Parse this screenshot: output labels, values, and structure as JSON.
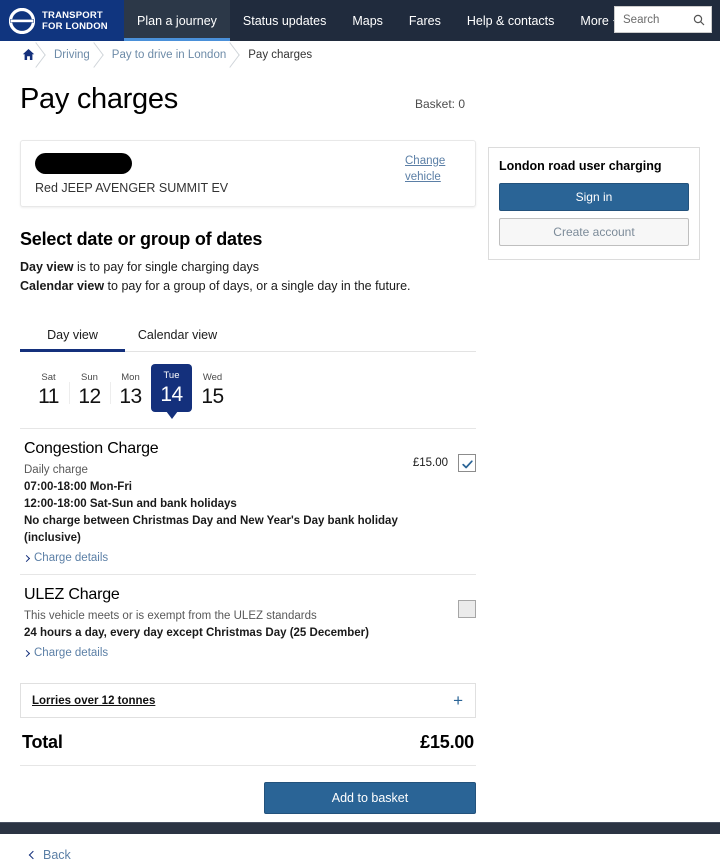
{
  "nav": {
    "logo_line1": "TRANSPORT",
    "logo_line2": "FOR LONDON",
    "logo_icon": "tfl-roundel-icon",
    "items": [
      {
        "label": "Plan a journey",
        "active": true
      },
      {
        "label": "Status updates",
        "active": false
      },
      {
        "label": "Maps",
        "active": false
      },
      {
        "label": "Fares",
        "active": false
      },
      {
        "label": "Help & contacts",
        "active": false
      },
      {
        "label": "More",
        "active": false,
        "caret": true
      }
    ],
    "search": {
      "placeholder": "Search",
      "value": "",
      "icon": "search-icon"
    }
  },
  "breadcrumb": {
    "home_icon": "home-icon",
    "items": [
      {
        "label": "Driving",
        "current": false
      },
      {
        "label": "Pay to drive in London",
        "current": false
      },
      {
        "label": "Pay charges",
        "current": true
      }
    ]
  },
  "header": {
    "title": "Pay charges",
    "basket": "Basket: 0"
  },
  "vehicle": {
    "registration": "",
    "registration_redacted": true,
    "description": "Red JEEP AVENGER SUMMIT EV",
    "change_link": "Change vehicle"
  },
  "sidebar": {
    "title": "London road user charging",
    "sign_in_label": "Sign in",
    "create_account_label": "Create account"
  },
  "select_date": {
    "heading": "Select date or group of dates",
    "line1_bold": "Day view",
    "line1_rest": " is to pay for single charging days",
    "line2_bold": "Calendar view",
    "line2_rest": " to pay for a group of days, or a single day in the future."
  },
  "tabs": [
    {
      "label": "Day view",
      "active": true
    },
    {
      "label": "Calendar view",
      "active": false
    }
  ],
  "dates": [
    {
      "day": "Sat",
      "num": "11",
      "selected": false
    },
    {
      "day": "Sun",
      "num": "12",
      "selected": false
    },
    {
      "day": "Mon",
      "num": "13",
      "selected": false
    },
    {
      "day": "Tue",
      "num": "14",
      "selected": true
    },
    {
      "day": "Wed",
      "num": "15",
      "selected": false
    }
  ],
  "charges": [
    {
      "title": "Congestion Charge",
      "subtitle": "Daily charge",
      "lines": [
        "07:00-18:00 Mon-Fri",
        "12:00-18:00 Sat-Sun and bank holidays",
        "No charge between Christmas Day and New Year's Day bank holiday (inclusive)"
      ],
      "details_label": "Charge details",
      "price": "£15.00",
      "checked": true,
      "disabled": false
    },
    {
      "title": "ULEZ Charge",
      "subtitle": "This vehicle meets or is exempt from the ULEZ standards",
      "lines": [
        "24 hours a day, every day except Christmas Day (25 December)"
      ],
      "details_label": "Charge details",
      "price": "",
      "checked": false,
      "disabled": true
    }
  ],
  "accordion": {
    "label": "Lorries over 12 tonnes",
    "icon": "plus-icon"
  },
  "total": {
    "label": "Total",
    "value": "£15.00"
  },
  "actions": {
    "add_to_basket": "Add to basket",
    "back": "Back",
    "back_icon": "chevron-left-icon"
  },
  "colors": {
    "tfl_blue": "#10357f",
    "nav_dark": "#202b3d",
    "accent_blue": "#2a6496",
    "selected_day": "#14307c",
    "link_blue": "#5b7fa6"
  }
}
